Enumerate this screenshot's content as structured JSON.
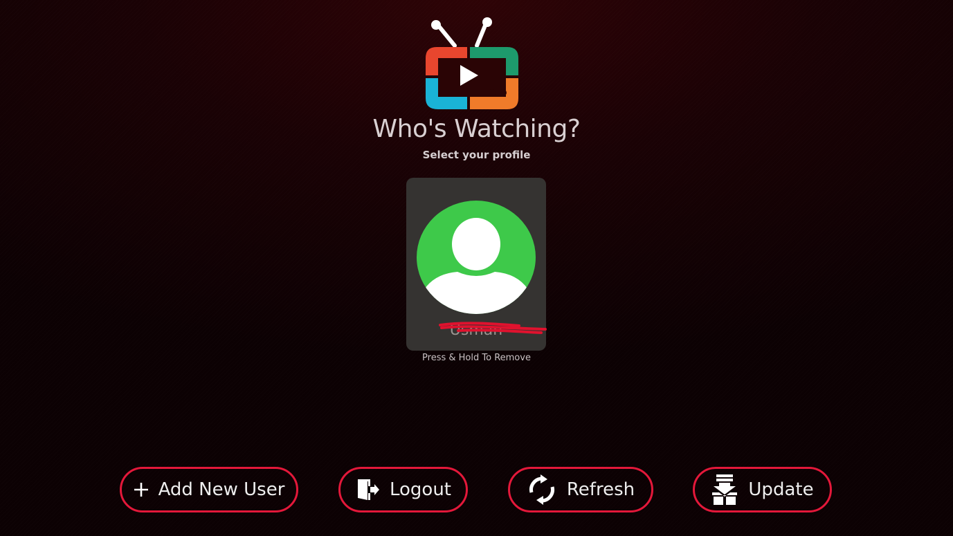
{
  "header": {
    "title": "Who's Watching?",
    "subtitle": "Select your profile"
  },
  "logo": {
    "icon": "tv-play-logo",
    "colors": [
      "#e8462e",
      "#1d9a6c",
      "#1ab3d6",
      "#f07b2a"
    ]
  },
  "profiles": [
    {
      "name": "Usman",
      "avatar_icon": "user-avatar-icon",
      "avatar_color": "#3ec94a"
    }
  ],
  "hint": "Press & Hold To Remove",
  "actions": {
    "add_user": {
      "label": "Add New User",
      "icon": "plus-icon"
    },
    "logout": {
      "label": "Logout",
      "icon": "logout-door-icon"
    },
    "refresh": {
      "label": "Refresh",
      "icon": "refresh-icon"
    },
    "update": {
      "label": "Update",
      "icon": "download-update-icon"
    }
  },
  "theme": {
    "accent": "#e3183a",
    "background": "#1a0205",
    "card": "#353331"
  }
}
